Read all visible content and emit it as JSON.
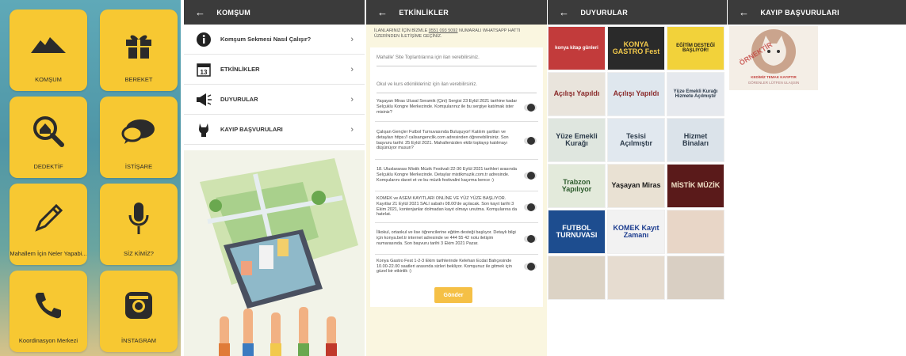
{
  "home": {
    "tiles": [
      {
        "label": "KOMŞUM",
        "icon": "houses-icon"
      },
      {
        "label": "BEREKET",
        "icon": "gift-icon"
      },
      {
        "label": "DEDEKTİF",
        "icon": "magnifier-house-icon"
      },
      {
        "label": "İSTİŞARE",
        "icon": "chat-bubbles-icon"
      },
      {
        "label": "Mahallem İçin Neler Yapabi...",
        "icon": "pencil-icon"
      },
      {
        "label": "SİZ KİMİZ?",
        "icon": "microphone-icon"
      },
      {
        "label": "Koordinasyon Merkezi",
        "icon": "phone-icon"
      },
      {
        "label": "İNSTAGRAM",
        "icon": "instagram-icon"
      }
    ]
  },
  "komsum": {
    "title": "KOMŞUM",
    "items": [
      {
        "label": "Komşum Sekmesi Nasıl Çalışır?",
        "icon": "info-icon"
      },
      {
        "label": "ETKİNLİKLER",
        "icon": "calendar-icon",
        "day": "13"
      },
      {
        "label": "DUYURULAR",
        "icon": "megaphone-icon"
      },
      {
        "label": "KAYIP BAŞVURULARI",
        "icon": "cat-icon"
      }
    ]
  },
  "etkinlikler": {
    "title": "ETKİNLİKLER",
    "note_prefix": "İLANLARINIZ İÇİN BİZMLE",
    "note_phone": "0551 093 5092",
    "note_suffix": "NUMARALI WHATSAPP HATTI ÜZERİNDEN İLETİŞİME GEÇİNİZ.",
    "fields": [
      "Mahalle' Site Toplantılarına için ilan verebilirsiniz.",
      "Okul ve kurs etkinlikleriniz için ilan verebilirsiniz."
    ],
    "questions": [
      "Yaşayan Miras Ulusal Seramik (Çini) Sergisi 23 Eylül 2021 tarihine kadar Selçuklu Kongre Merkezinde. Komşularınız ile bu sergiye katılmak ister misiniz?",
      "Çalışan Gençler Futbol Turnuvasında Buluşuyor! Katılım şartları ve detayları https:// calisangenclik.com adresinden öğrenebilirsiniz. Son başvuru tarihi: 25 Eylül 2021. Mahallenizden ekibi toplayıp katılmayı düşünüyor musun?",
      "18. Uluslararası Mistik Müzik Festivali 22-30 Eylül 2021 tarihleri arasında Selçuklu Kongre Merkezinde. Detaylar mistikmuzik.com.tr adresinde. Komşularını davet et ve bu müzik festivalini kaçırma bence :)",
      "KOMEK ve ASEM KAYITLARI ONLİNE VE YÜZ YÜZE BAŞLIYOR. Kayıtlar 21 Eylül 2021 SALI sabahı 08.00'de açılacak. Son kayıt tarihi 3 Ekim 2021, kontenjanlar dolmadan kayıt olmayı unutma. Komşularına da hatırlat.",
      "İlkokul, ortaokul ve lise öğrencilerine eğitim desteği başlıyor. Detaylı bilgi için konya.bel.tr internet adresinde ve 444 55 42 nolu iletişim numarasında. Son başvuru tarihi 3 Ekim 2021 Pazar.",
      "Konya Gastro Fest 1-2-3 Ekim tarihlerinde Kelehan Ecdat Bahçesinde 10.00-22.00 saatleri arasında sizleri bekliyor. Komşunuz ile gitmek için güzel bir etkinlik :)"
    ],
    "send_label": "Gönder"
  },
  "duyurular": {
    "title": "DUYURULAR",
    "posters": [
      {
        "text": "konya kitap günleri",
        "bg": "#c23b3b",
        "fg": "#ffffff"
      },
      {
        "text": "KONYA GASTRO Fest",
        "bg": "#2a2a2a",
        "fg": "#f2c94c"
      },
      {
        "text": "EĞİTİM DESTEĞİ BAŞLIYOR!",
        "bg": "#f2d23a",
        "fg": "#1a1a1a"
      },
      {
        "text": "Açılışı Yapıldı",
        "bg": "#e9e4dc",
        "fg": "#8a2b2b"
      },
      {
        "text": "Açılışı Yapıldı",
        "bg": "#dfe7ee",
        "fg": "#8a2b2b"
      },
      {
        "text": "Yüze Emekli Kurağı Hizmete Açılmıştır",
        "bg": "#e6e9ee",
        "fg": "#2b3a4a"
      },
      {
        "text": "Yüze Emekli Kurağı",
        "bg": "#dfe6df",
        "fg": "#2b3a4a"
      },
      {
        "text": "Tesisi Açılmıştır",
        "bg": "#e1e8ef",
        "fg": "#2b3a4a"
      },
      {
        "text": "Hizmet Binaları",
        "bg": "#dbe3ea",
        "fg": "#2b3a4a"
      },
      {
        "text": "Trabzon Yapılıyor",
        "bg": "#e3eadb",
        "fg": "#2b5a2b"
      },
      {
        "text": "Yaşayan Miras",
        "bg": "#e9e1d3",
        "fg": "#1a1a1a"
      },
      {
        "text": "MİSTİK MÜZİK",
        "bg": "#5a1a1a",
        "fg": "#f2e3c9"
      },
      {
        "text": "FUTBOL TURNUVASI",
        "bg": "#1d4d8f",
        "fg": "#ffffff"
      },
      {
        "text": "KOMEK Kayıt Zamanı",
        "bg": "#f2f2f2",
        "fg": "#1d3d8f"
      },
      {
        "text": "",
        "bg": "#e8d6c7",
        "fg": "#8a2b2b"
      },
      {
        "text": "",
        "bg": "#dcd3c5",
        "fg": "#333333"
      },
      {
        "text": "",
        "bg": "#e6dcd0",
        "fg": "#333333"
      },
      {
        "text": "",
        "bg": "#d9cfc3",
        "fg": "#333333"
      }
    ]
  },
  "kayip": {
    "title": "KAYIP BAŞVURULARI",
    "card_caption": "KEDİMİZ TEMAK KAYIPTIR",
    "card_sub": "GÖRENLER LÜTFEN ULAŞSIN",
    "stamp": "ÖRNEKTİR"
  },
  "colors": {
    "tile": "#f7c832",
    "bar": "#3b3b3b",
    "accent": "#f5c046"
  }
}
